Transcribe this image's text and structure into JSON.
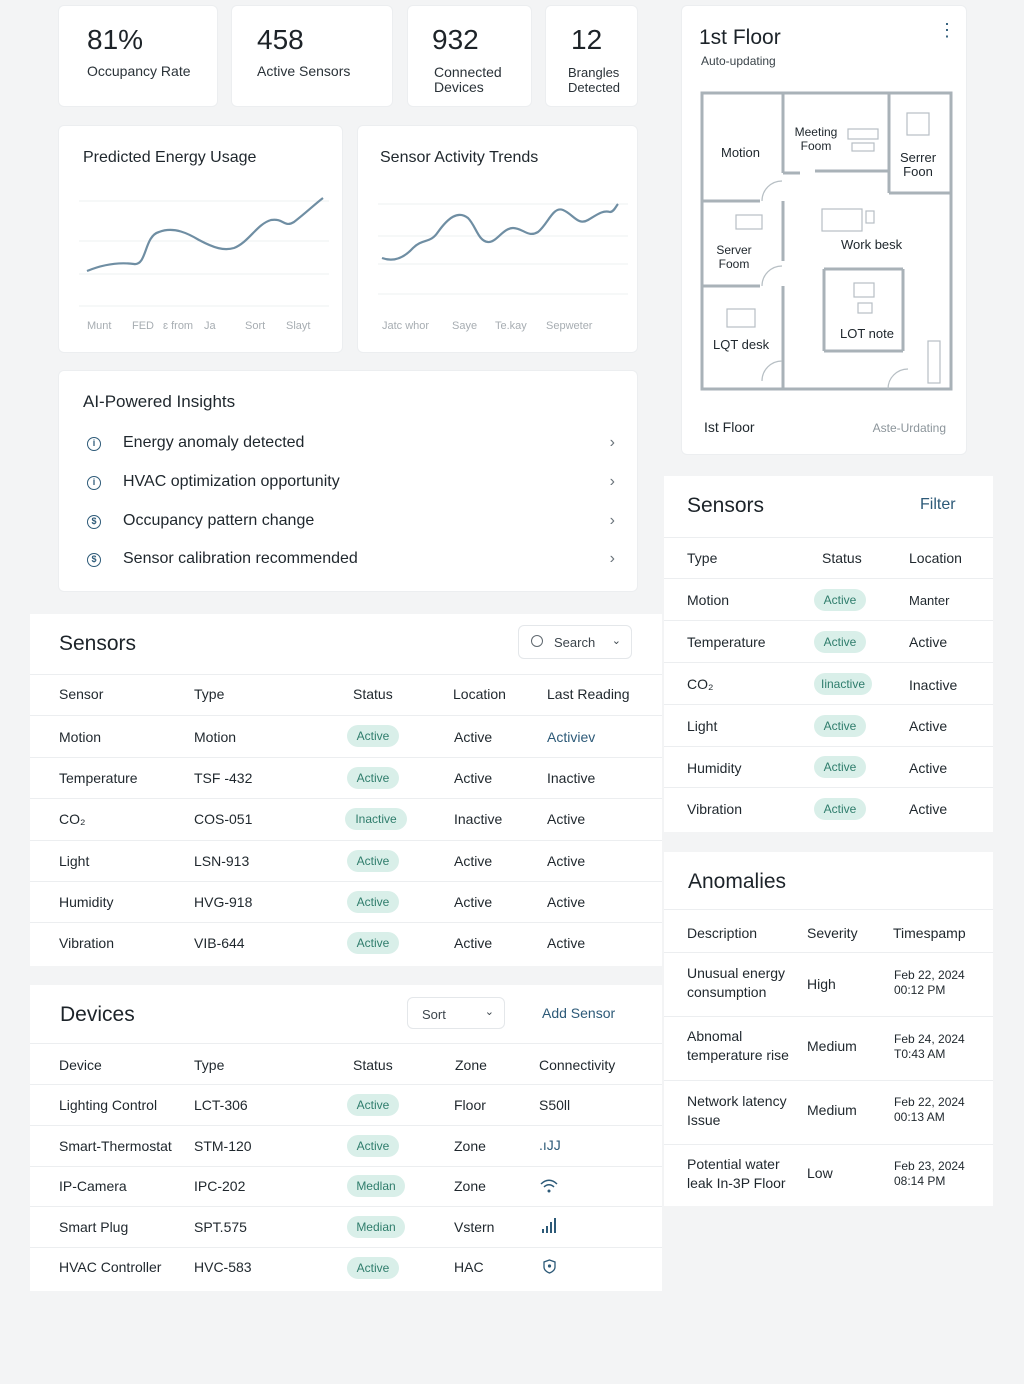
{
  "stats": [
    {
      "value": "81%",
      "label": "Occupancy Rate"
    },
    {
      "value": "458",
      "label": "Active Sensors"
    },
    {
      "value": "932",
      "label": "Connected Devices"
    },
    {
      "value": "12",
      "label": "Brangles Detected"
    }
  ],
  "energy_chart": {
    "title": "Predicted Energy Usage",
    "ticks": [
      "Munt",
      "FED",
      "ɛ from",
      "Ja",
      "Sort",
      "Slayt"
    ]
  },
  "activity_chart": {
    "title": "Sensor Activity Trends",
    "ticks": [
      "Jatc whor",
      "Saye",
      "Te.kay",
      "Sepweter"
    ]
  },
  "insights": {
    "title": "AI-Powered Insights",
    "items": [
      "Energy anomaly detected",
      "HVAC optimization opportunity",
      "Occupancy pattern change",
      "Sensor calibration recommended"
    ]
  },
  "sensors_main": {
    "title": "Sensors",
    "search_label": "Search",
    "columns": [
      "Sensor",
      "Type",
      "Status",
      "Location",
      "Last Reading"
    ],
    "rows": [
      {
        "sensor": "Motion",
        "type": "Motion",
        "status": "Active",
        "location": "Active",
        "reading": "Activiev"
      },
      {
        "sensor": "Temperature",
        "type": "TSF -432",
        "status": "Active",
        "location": "Active",
        "reading": "Inactive"
      },
      {
        "sensor": "CO₂",
        "type": "COS-051",
        "status": "Inactive",
        "location": "Inactive",
        "reading": "Active"
      },
      {
        "sensor": "Light",
        "type": "LSN-913",
        "status": "Active",
        "location": "Active",
        "reading": "Active"
      },
      {
        "sensor": "Humidity",
        "type": "HVG-918",
        "status": "Active",
        "location": "Active",
        "reading": "Active"
      },
      {
        "sensor": "Vibration",
        "type": "VIB-644",
        "status": "Active",
        "location": "Active",
        "reading": "Active"
      }
    ]
  },
  "devices": {
    "title": "Devices",
    "sort_label": "Sort",
    "add_label": "Add Sensor",
    "columns": [
      "Device",
      "Type",
      "Status",
      "Zone",
      "Connectivity"
    ],
    "rows": [
      {
        "device": "Lighting Control",
        "type": "LCT-306",
        "status": "Active",
        "zone": "Floor",
        "conn": "S50ll"
      },
      {
        "device": "Smart-Thermostat",
        "type": "STM-120",
        "status": "Active",
        "zone": "Zone",
        "conn": ".ıJJ"
      },
      {
        "device": "IP-Camera",
        "type": "IPC-202",
        "status": "Medlan",
        "zone": "Zone",
        "conn": "wifi-icon"
      },
      {
        "device": "Smart Plug",
        "type": "SPT.575",
        "status": "Median",
        "zone": "Vstern",
        "conn": "signal-bars-icon"
      },
      {
        "device": "HVAC Controller",
        "type": "HVC-583",
        "status": "Active",
        "zone": "HAC",
        "conn": "shield-icon"
      }
    ]
  },
  "floor": {
    "title": "1st Floor",
    "subtitle": "Auto-updating",
    "footer_left": "Ist Floor",
    "footer_right": "Aste-Urdating",
    "rooms": [
      "Motion",
      "Meeting Foom",
      "Serrer Foon",
      "Server Foom",
      "Work besk",
      "LQT desk",
      "LOT note"
    ]
  },
  "sensors_side": {
    "title": "Sensors",
    "filter_label": "Filter",
    "columns": [
      "Type",
      "Status",
      "Location"
    ],
    "rows": [
      {
        "type": "Motion",
        "status": "Active",
        "location": "Manter"
      },
      {
        "type": "Temperature",
        "status": "Active",
        "location": "Active"
      },
      {
        "type": "CO₂",
        "status": "Iinactive",
        "location": "Inactive"
      },
      {
        "type": "Light",
        "status": "Active",
        "location": "Active"
      },
      {
        "type": "Humidity",
        "status": "Active",
        "location": "Active"
      },
      {
        "type": "Vibration",
        "status": "Active",
        "location": "Active"
      }
    ]
  },
  "anomalies": {
    "title": "Anomalies",
    "columns": [
      "Description",
      "Severity",
      "Timespamp"
    ],
    "rows": [
      {
        "desc": "Unusual energy consumption",
        "severity": "High",
        "time": "Feb 22, 2024 00:12 PM"
      },
      {
        "desc": "Abnomal temperature rise",
        "severity": "Medium",
        "time": "Feb 24, 2024 T0:43 AM"
      },
      {
        "desc": "Network latency Issue",
        "severity": "Medium",
        "time": "Feb 22, 2024 00:13 AM"
      },
      {
        "desc": "Potential water leak In-3P Floor",
        "severity": "Low",
        "time": "Feb 23, 2024 08:14 PM"
      }
    ]
  },
  "colors": {
    "accent": "#2d5a78",
    "badge_bg": "#d9efe9",
    "badge_text": "#2f7d6c"
  }
}
